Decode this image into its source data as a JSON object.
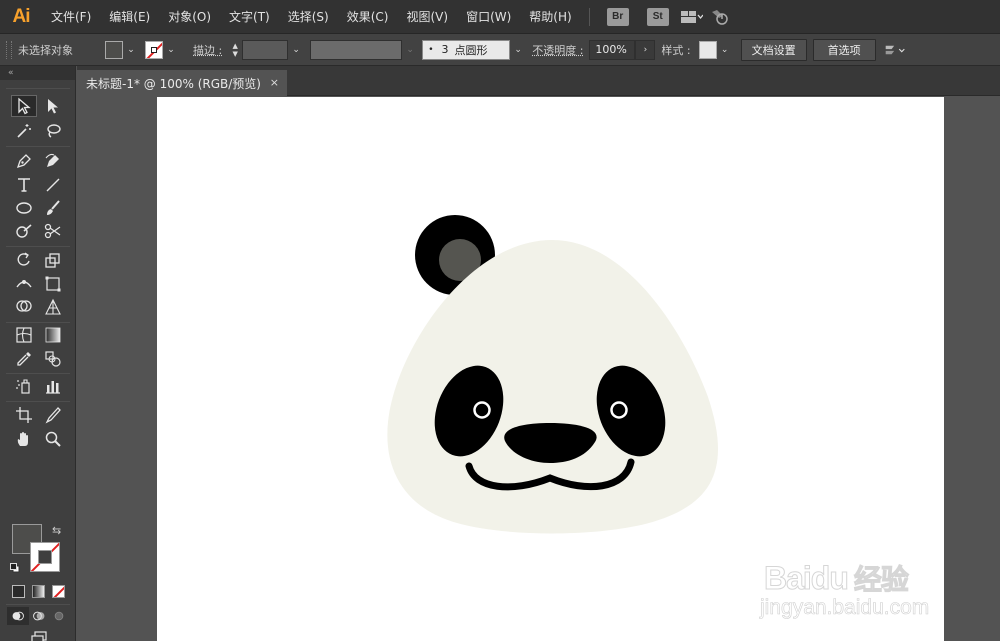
{
  "app": {
    "logo": "Ai"
  },
  "menu": [
    "文件(F)",
    "编辑(E)",
    "对象(O)",
    "文字(T)",
    "选择(S)",
    "效果(C)",
    "视图(V)",
    "窗口(W)",
    "帮助(H)"
  ],
  "menubar_buttons": {
    "bridge": "Br",
    "stock": "St"
  },
  "control": {
    "selection_status": "未选择对象",
    "stroke_label": "描边 :",
    "brush_point": "3",
    "brush_shape": "点圆形",
    "opacity_label": "不透明度 :",
    "opacity_value": "100%",
    "style_label": "样式 :",
    "doc_setup_button": "文档设置",
    "preferences_button": "首选项"
  },
  "tools_header": "«",
  "document": {
    "tab_title": "未标题-1* @ 100% (RGB/预览)",
    "close": "×"
  },
  "colors": {
    "fill": "#4d4d4b",
    "panda_face": "#f2f2e9",
    "panda_black": "#000000",
    "panda_ear_inner": "#555550",
    "ai_orange": "#f7a12c"
  },
  "watermark": {
    "brand": "Baidu",
    "product": "经验",
    "url": "jingyan.baidu.com"
  }
}
